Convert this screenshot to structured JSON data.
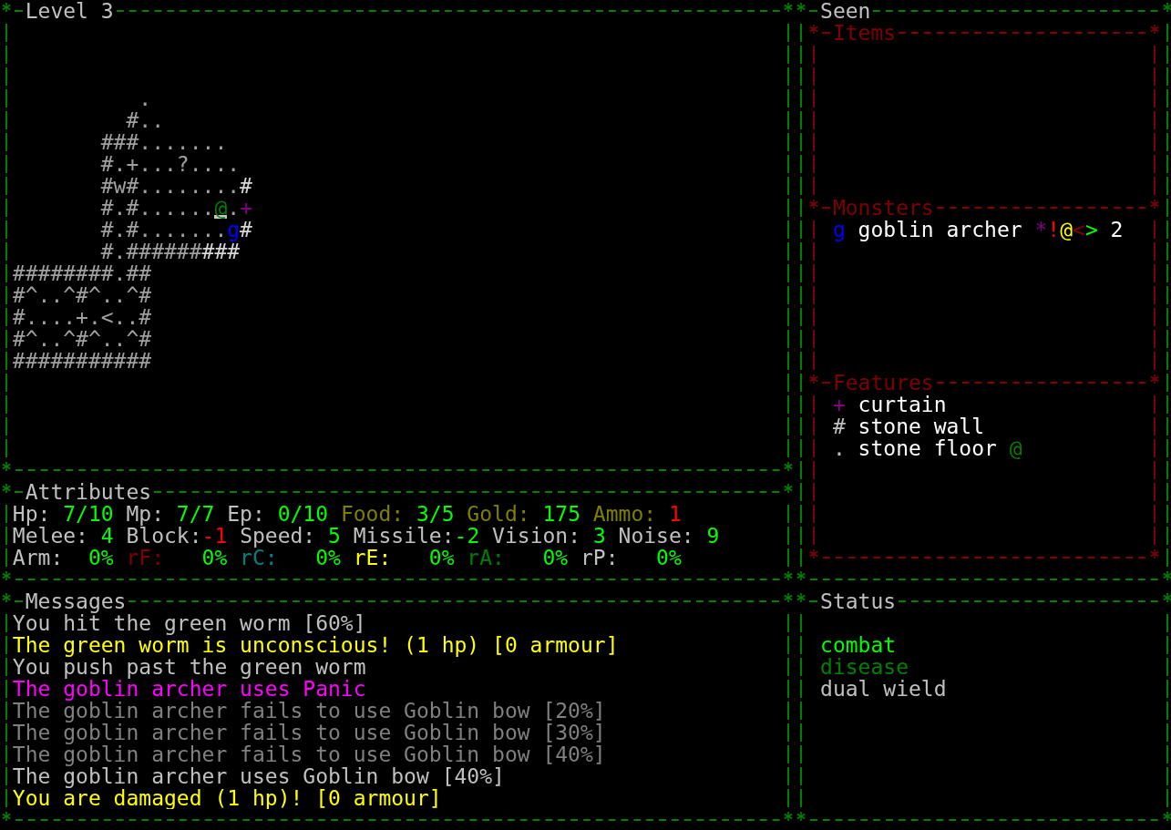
{
  "map": {
    "title": "Level 3",
    "rows": [
      {
        "spans": [
          {
            "text": "          .",
            "color": "#a0a0a0"
          }
        ]
      },
      {
        "spans": [
          {
            "text": "         #..",
            "color": "#a0a0a0"
          }
        ]
      },
      {
        "spans": [
          {
            "text": "       ###.......",
            "color": "#a0a0a0"
          }
        ]
      },
      {
        "spans": [
          {
            "text": "       #.+...?....",
            "color": "#a0a0a0"
          }
        ]
      },
      {
        "spans": [
          {
            "text": "       #w#........",
            "color": "#a0a0a0"
          },
          {
            "text": "#",
            "color": "#d8d8d8"
          }
        ]
      },
      {
        "spans": [
          {
            "text": "       #.#......",
            "color": "#a0a0a0"
          },
          {
            "text": "@",
            "color": "#008000",
            "cursor": true
          },
          {
            "text": ".",
            "color": "#a0a0a0"
          },
          {
            "text": "+",
            "color": "#800080"
          }
        ]
      },
      {
        "spans": [
          {
            "text": "       #.#.......",
            "color": "#a0a0a0"
          },
          {
            "text": "g",
            "color": "#0000ff"
          },
          {
            "text": "#",
            "color": "#d8d8d8"
          }
        ]
      },
      {
        "spans": [
          {
            "text": "       #.######",
            "color": "#a0a0a0"
          },
          {
            "text": "###",
            "color": "#d8d8d8"
          }
        ]
      },
      {
        "spans": [
          {
            "text": "########.##",
            "color": "#a0a0a0"
          }
        ]
      },
      {
        "spans": [
          {
            "text": "#^..^#^..^#",
            "color": "#a0a0a0"
          }
        ]
      },
      {
        "spans": [
          {
            "text": "#....+.<..#",
            "color": "#a0a0a0"
          }
        ]
      },
      {
        "spans": [
          {
            "text": "#^..^#^..^#",
            "color": "#a0a0a0"
          }
        ]
      },
      {
        "spans": [
          {
            "text": "###########",
            "color": "#a0a0a0"
          }
        ]
      }
    ]
  },
  "attributes": {
    "title": "Attributes",
    "rows": [
      {
        "kind": "stats",
        "stats": [
          {
            "label": {
              "text": "Hp: ",
              "color": "#c0c0c0"
            },
            "value": {
              "text": "7/10",
              "color": "#00ff00"
            }
          },
          {
            "label": {
              "text": "Mp: ",
              "color": "#c0c0c0"
            },
            "value": {
              "text": "7/7",
              "color": "#00ff00"
            }
          },
          {
            "label": {
              "text": "Ep: ",
              "color": "#c0c0c0"
            },
            "value": {
              "text": "0/10",
              "color": "#00ff00"
            }
          },
          {
            "label": {
              "text": "Food: ",
              "color": "#808000"
            },
            "value": {
              "text": "3/5",
              "color": "#00ff00"
            }
          },
          {
            "label": {
              "text": "Gold: ",
              "color": "#808000"
            },
            "value": {
              "text": "175",
              "color": "#00ff00"
            }
          },
          {
            "label": {
              "text": "Ammo: ",
              "color": "#808000"
            },
            "value": {
              "text": "1",
              "color": "#ff0000"
            }
          }
        ]
      },
      {
        "kind": "stats",
        "stats": [
          {
            "label": {
              "text": "Melee: ",
              "color": "#c0c0c0"
            },
            "value": {
              "text": "4",
              "color": "#00ff00"
            }
          },
          {
            "label": {
              "text": "Block:",
              "color": "#c0c0c0"
            },
            "value": {
              "text": "-1",
              "color": "#ff0000"
            }
          },
          {
            "label": {
              "text": "Speed: ",
              "color": "#c0c0c0"
            },
            "value": {
              "text": "5",
              "color": "#00ff00"
            }
          },
          {
            "label": {
              "text": "Missile:",
              "color": "#c0c0c0"
            },
            "value": {
              "text": "-2",
              "color": "#00ff00"
            }
          },
          {
            "label": {
              "text": "Vision: ",
              "color": "#c0c0c0"
            },
            "value": {
              "text": "3",
              "color": "#00ff00"
            }
          },
          {
            "label": {
              "text": "Noise: ",
              "color": "#c0c0c0"
            },
            "value": {
              "text": "9",
              "color": "#00ff00"
            }
          }
        ]
      },
      {
        "kind": "resistances",
        "stats": [
          {
            "label": {
              "text": "Arm:",
              "color": "#c0c0c0"
            },
            "value": {
              "text": "0%",
              "color": "#00ff00"
            }
          },
          {
            "label": {
              "text": "rF:",
              "color": "#800000"
            },
            "value": {
              "text": "0%",
              "color": "#00ff00"
            }
          },
          {
            "label": {
              "text": "rC:",
              "color": "#008080"
            },
            "value": {
              "text": "0%",
              "color": "#00ff00"
            }
          },
          {
            "label": {
              "text": "rE:",
              "color": "#ffff00"
            },
            "value": {
              "text": "0%",
              "color": "#00ff00"
            }
          },
          {
            "label": {
              "text": "rA:",
              "color": "#008000"
            },
            "value": {
              "text": "0%",
              "color": "#00ff00"
            }
          },
          {
            "label": {
              "text": "rP:",
              "color": "#c0c0c0"
            },
            "value": {
              "text": "0%",
              "color": "#00ff00"
            }
          }
        ]
      }
    ]
  },
  "messages": {
    "title": "Messages",
    "lines": [
      {
        "text": "You hit the green worm [60%]",
        "color": "#c0c0c0"
      },
      {
        "text": "The green worm is unconscious! (1 hp) [0 armour]",
        "color": "#ffff00"
      },
      {
        "text": "You push past the green worm",
        "color": "#c0c0c0"
      },
      {
        "text": "The goblin archer uses Panic",
        "color": "#ff00ff"
      },
      {
        "text": "The goblin archer fails to use Goblin bow [20%]",
        "color": "#808080"
      },
      {
        "text": "The goblin archer fails to use Goblin bow [30%]",
        "color": "#808080"
      },
      {
        "text": "The goblin archer fails to use Goblin bow [40%]",
        "color": "#808080"
      },
      {
        "text": "The goblin archer uses Goblin bow [40%]",
        "color": "#c0c0c0"
      },
      {
        "text": "You are damaged (1 hp)! [0 armour]",
        "color": "#ffff00"
      }
    ]
  },
  "seen": {
    "title": "Seen",
    "items": {
      "title": "Items"
    },
    "monsters": {
      "title": "Monsters",
      "list": [
        {
          "glyph": "g",
          "color": "#0000ff",
          "name": "goblin archer",
          "flags": [
            {
              "text": "*",
              "color": "#800080"
            },
            {
              "text": "!",
              "color": "#ff0000"
            },
            {
              "text": "@",
              "color": "#ffff00"
            },
            {
              "text": "<",
              "color": "#800000"
            },
            {
              "text": ">",
              "color": "#00ff00"
            }
          ],
          "count": "2"
        }
      ]
    },
    "features": {
      "title": "Features",
      "list": [
        {
          "glyph": "+",
          "color": "#800080",
          "name": "curtain"
        },
        {
          "glyph": "#",
          "color": "#c0c0c0",
          "name": "stone wall"
        },
        {
          "glyph": ".",
          "color": "#c0c0c0",
          "name": "stone floor",
          "marker": {
            "text": "@",
            "color": "#008000"
          }
        }
      ]
    }
  },
  "status": {
    "title": "Status",
    "items": [
      {
        "text": "combat",
        "color": "#00ff00"
      },
      {
        "text": "disease",
        "color": "#008000"
      },
      {
        "text": "dual wield",
        "color": "#c0c0c0"
      }
    ]
  }
}
